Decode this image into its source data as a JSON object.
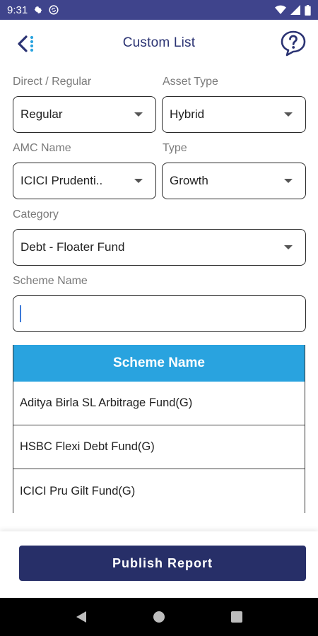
{
  "status_bar": {
    "time": "9:31"
  },
  "header": {
    "title": "Custom List"
  },
  "form": {
    "direct_regular": {
      "label": "Direct / Regular",
      "value": "Regular"
    },
    "asset_type": {
      "label": "Asset Type",
      "value": "Hybrid"
    },
    "amc_name": {
      "label": "AMC Name",
      "value": "ICICI Prudenti.."
    },
    "type": {
      "label": "Type",
      "value": "Growth"
    },
    "category": {
      "label": "Category",
      "value": "Debt - Floater Fund"
    },
    "scheme_name": {
      "label": "Scheme Name",
      "value": "",
      "placeholder": ""
    }
  },
  "table": {
    "header": "Scheme Name",
    "rows": [
      "Aditya Birla SL Arbitrage Fund(G)",
      "HSBC Flexi Debt Fund(G)",
      "ICICI Pru Gilt Fund(G)"
    ]
  },
  "actions": {
    "publish_label": "Publish Report"
  },
  "colors": {
    "status_bar": "#3f448c",
    "title": "#2b3373",
    "table_header": "#29a3df",
    "primary_button": "#272f68"
  },
  "icons": {
    "back": "back-arrow-dots-icon",
    "help": "help-question-icon",
    "settings": "gear-icon",
    "sync": "sync-icon",
    "wifi": "wifi-icon",
    "signal": "signal-icon",
    "battery": "battery-icon"
  }
}
